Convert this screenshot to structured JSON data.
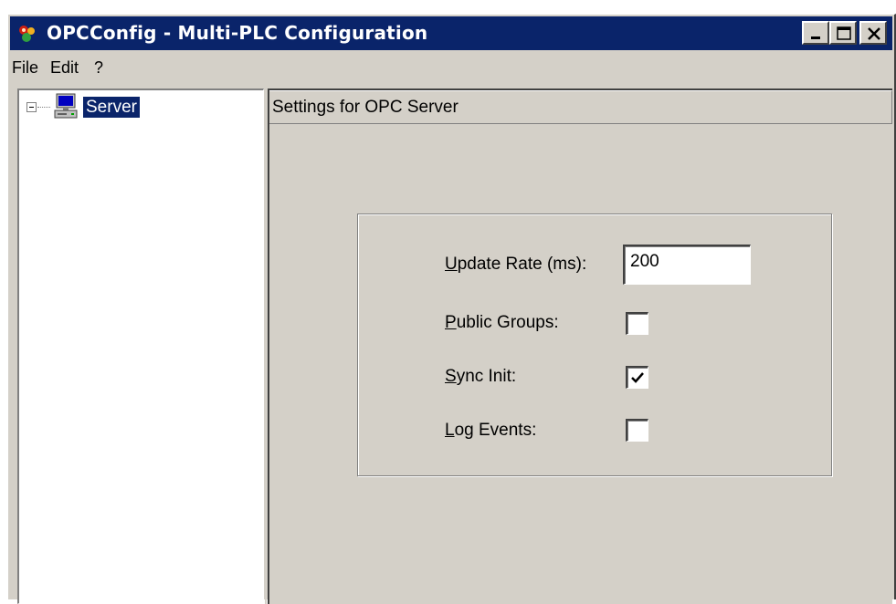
{
  "window": {
    "title": "OPCConfig - Multi-PLC Configuration",
    "titlebar_color": "#0a246a",
    "face_color": "#d4d0c8"
  },
  "title_buttons": [
    {
      "name": "minimize",
      "icon": "minimize-icon"
    },
    {
      "name": "maximize",
      "icon": "maximize-icon"
    },
    {
      "name": "close",
      "icon": "close-icon"
    }
  ],
  "menu": [
    {
      "label": "File"
    },
    {
      "label": "Edit"
    },
    {
      "label": "?"
    }
  ],
  "tree": {
    "root": {
      "label": "Server",
      "icon": "computer-icon",
      "expanded": true,
      "selected": true
    }
  },
  "panel": {
    "header": "Settings for OPC Server",
    "fields": {
      "update_rate": {
        "label_mnemonic": "U",
        "label_rest": "pdate Rate (ms):",
        "value": "200"
      },
      "public_groups": {
        "label_mnemonic": "P",
        "label_rest": "ublic Groups:",
        "checked": false
      },
      "sync_init": {
        "label_mnemonic": "S",
        "label_rest": "ync Init:",
        "checked": true
      },
      "log_events": {
        "label_mnemonic": "L",
        "label_rest": "og Events:",
        "checked": false
      }
    }
  }
}
